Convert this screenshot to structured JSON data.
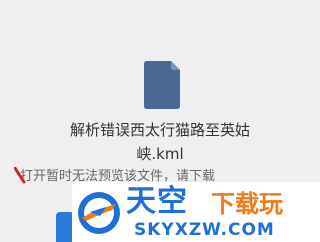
{
  "file": {
    "icon": "document-icon",
    "name": "解析错误西太行猫路至英姑峡.kml"
  },
  "notice": {
    "message": "打开暂时无法预览该文件，",
    "download_link": "请下载"
  },
  "watermark": {
    "logo_icon": "airplane-logo-icon",
    "brand": "天空",
    "tagline": "下载玩",
    "domain": "SKYXZW.COM"
  },
  "colors": {
    "background": "#efeff1",
    "file_icon": "#4a6894",
    "brand_blue": "#1f6fd8",
    "brand_orange": "#f07a1a",
    "accent_red": "#d92424"
  }
}
